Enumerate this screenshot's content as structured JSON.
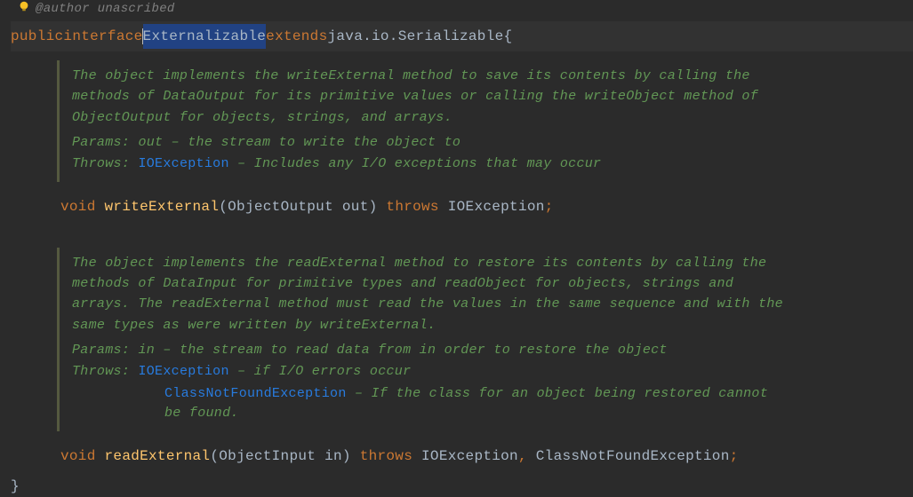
{
  "top": {
    "author_label": "@author",
    "author_value": "unascribed"
  },
  "decl": {
    "kw_public": "public",
    "kw_interface": "interface",
    "class_name": "Externalizable",
    "kw_extends": "extends",
    "super_type": "java.io.Serializable",
    "open_brace": "{"
  },
  "doc1": {
    "body": "The object implements the writeExternal method to save its contents by calling the methods of DataOutput for its primitive values or calling the writeObject method of ObjectOutput for objects, strings, and arrays.",
    "params_label": "Params:",
    "params_text": "out – the stream to write the object to",
    "throws_label": "Throws:",
    "throws_link": "IOException",
    "throws_text": " – Includes any I/O exceptions that may occur"
  },
  "method1": {
    "kw_void": "void",
    "name": "writeExternal",
    "open_paren": "(",
    "param_type": "ObjectOutput",
    "param_name": "out",
    "close_paren": ")",
    "kw_throws": "throws",
    "exc1": "IOException",
    "semi": ";"
  },
  "doc2": {
    "body": "The object implements the readExternal method to restore its contents by calling the methods of DataInput for primitive types and readObject for objects, strings and arrays. The readExternal method must read the values in the same sequence and with the same types as were written by writeExternal.",
    "params_label": "Params:",
    "params_text": "in – the stream to read data from in order to restore the object",
    "throws_label": "Throws:",
    "throws_link1": "IOException",
    "throws_text1": " – if I/O errors occur",
    "throws_link2": "ClassNotFoundException",
    "throws_text2": " – If the class for an object being restored cannot be found."
  },
  "method2": {
    "kw_void": "void",
    "name": "readExternal",
    "open_paren": "(",
    "param_type": "ObjectInput",
    "param_name": "in",
    "close_paren": ")",
    "kw_throws": "throws",
    "exc1": "IOException",
    "comma": ",",
    "exc2": "ClassNotFoundException",
    "semi": ";"
  },
  "close_brace": "}"
}
